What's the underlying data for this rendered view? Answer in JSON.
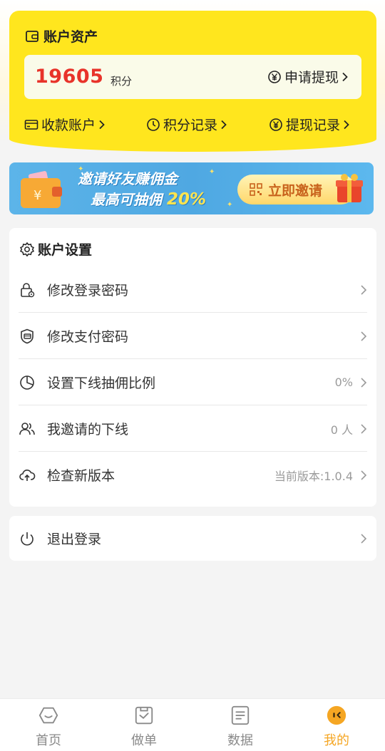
{
  "assets": {
    "title": "账户资产",
    "points_value": "19605",
    "points_unit": "积分",
    "withdraw_label": "申请提现",
    "quick_links": [
      {
        "label": "收款账户",
        "icon": "card-icon"
      },
      {
        "label": "积分记录",
        "icon": "clock-icon"
      },
      {
        "label": "提现记录",
        "icon": "yuan-icon"
      }
    ]
  },
  "banner": {
    "line1": "邀请好友赚佣金",
    "line2_prefix": "最高可抽佣",
    "line2_percent": "20%",
    "cta_label": "立即邀请"
  },
  "settings": {
    "title": "账户设置",
    "rows": [
      {
        "label": "修改登录密码",
        "value": "",
        "icon": "lock-icon"
      },
      {
        "label": "修改支付密码",
        "value": "",
        "icon": "shield-card-icon"
      },
      {
        "label": "设置下线抽佣比例",
        "value": "0%",
        "icon": "pie-chart-icon"
      },
      {
        "label": "我邀请的下线",
        "value": "0 人",
        "icon": "users-icon"
      },
      {
        "label": "检查新版本",
        "value": "当前版本:1.0.4",
        "icon": "cloud-upload-icon"
      }
    ]
  },
  "logout": {
    "label": "退出登录",
    "icon": "power-icon"
  },
  "tabbar": {
    "tabs": [
      {
        "label": "首页",
        "icon": "home-face-icon",
        "active": false
      },
      {
        "label": "做单",
        "icon": "task-icon",
        "active": false
      },
      {
        "label": "数据",
        "icon": "document-icon",
        "active": false
      },
      {
        "label": "我的",
        "icon": "profile-face-icon",
        "active": true
      }
    ],
    "active_color": "#f5a623",
    "inactive_color": "#8a8a8a"
  },
  "colors": {
    "accent_yellow": "#ffe61e",
    "points_red": "#e8332a",
    "banner_blue": "#4fa8e2"
  }
}
